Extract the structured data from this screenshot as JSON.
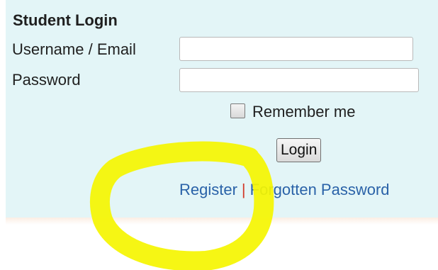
{
  "form": {
    "title": "Student Login",
    "username_label": "Username / Email",
    "username_value": "",
    "password_label": "Password",
    "password_value": "",
    "remember_label": "Remember me",
    "remember_checked": false,
    "login_label": "Login"
  },
  "links": {
    "register": "Register",
    "separator": "|",
    "forgot": "Forgotten Password"
  },
  "colors": {
    "panel_bg": "#e3f5f7",
    "link": "#2a62a8",
    "separator": "#d23a2a",
    "highlight_marker": "#f5f500"
  }
}
